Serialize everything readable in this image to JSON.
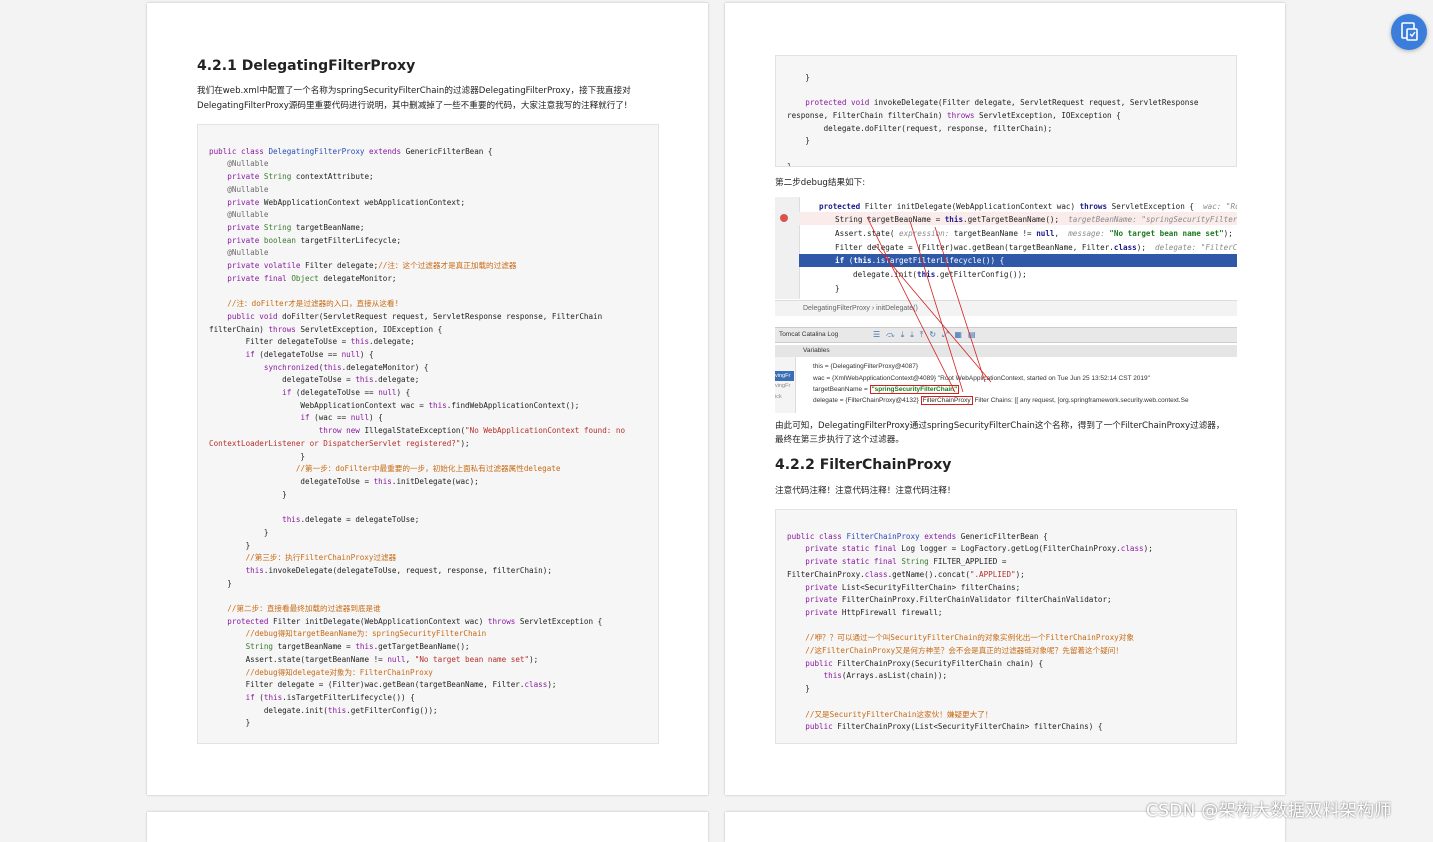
{
  "page1": {
    "heading": "4.2.1 DelegatingFilterProxy",
    "intro_line1": "我们在web.xml中配置了一个名称为springSecurityFilterChain的过滤器DelegatingFilterProxy，接下我直接对",
    "intro_line2": "DelegatingFilterProxy源码里重要代码进行说明，其中删减掉了一些不重要的代码，大家注意我写的注释就行了!"
  },
  "page2": {
    "debug_label": "第二步debug结果如下:",
    "conclusion_line1": "由此可知，DelegatingFilterProxy通过springSecurityFilterChain这个名称，得到了一个FilterChainProxy过滤器，",
    "conclusion_line2": "最终在第三步执行了这个过滤器。",
    "heading": "4.2.2 FilterChainProxy",
    "note": "注意代码注释！注意代码注释！注意代码注释！"
  },
  "ide": {
    "breadcrumb": "DelegatingFilterProxy  ›  initDelegate()",
    "console_tab": "Tomcat Catalina Log",
    "variables_label": "Variables",
    "var_this": "this = {DelegatingFilterProxy@4087}",
    "var_wac": "wac = {XmlWebApplicationContext@4089} \"Root WebApplicationContext, started on Tue Jun 25 13:52:14 CST 2019\"",
    "var_target": "targetBeanName = ",
    "var_target_value": "\"springSecurityFilterChain\"",
    "var_delegate_pre": "delegate = {FilterChainProxy@4132} ",
    "var_delegate_box": "FilterChainProxy",
    "var_delegate_post": " Filter Chains: [[ any request, [org.springframework.security.web.context.Se",
    "frames": [
      "vingFr",
      "vingFr",
      "ick"
    ]
  },
  "watermark": "CSDN @架构大数据双料架构师",
  "fab_icon": "pdf-convert-icon",
  "colors": {
    "keyword": "#8a1aa0",
    "type": "#3b7a2f",
    "comment": "#c86a14",
    "string": "#b5302b",
    "accent": "#3a7ddb",
    "debug_highlight": "#2f58a8"
  }
}
